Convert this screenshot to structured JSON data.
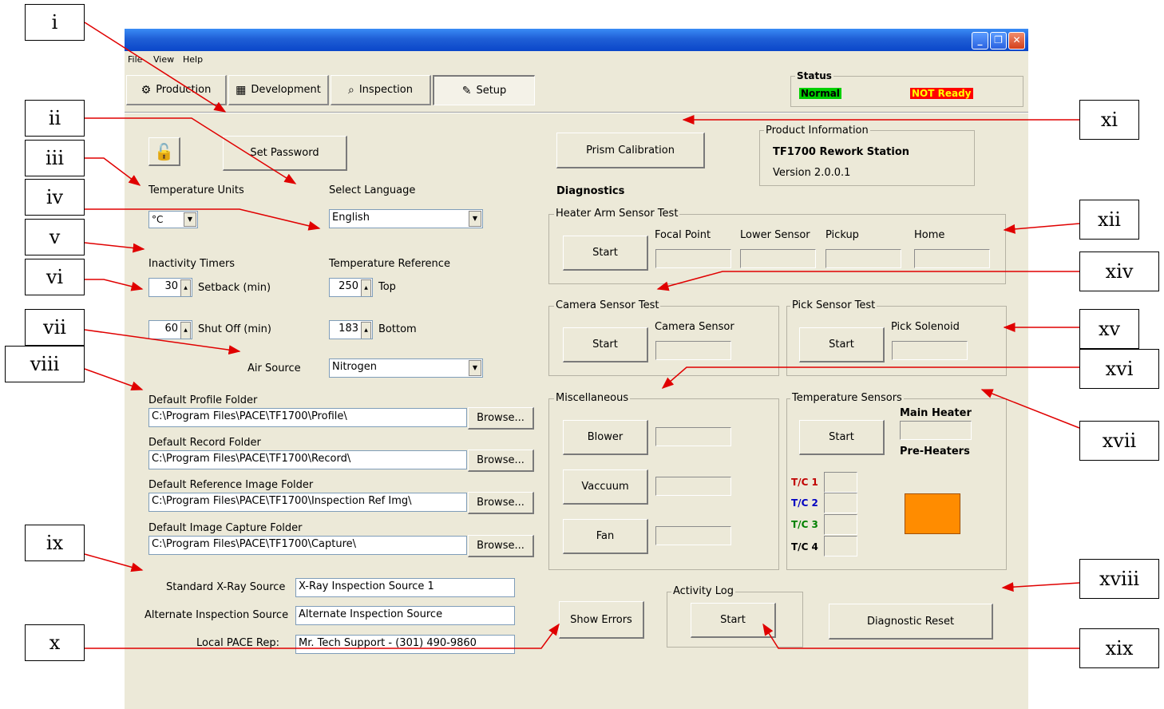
{
  "menu": {
    "file": "File",
    "view": "View",
    "help": "Help"
  },
  "tabs": [
    {
      "label": "Production",
      "icon": "production-icon"
    },
    {
      "label": "Development",
      "icon": "calculator-icon"
    },
    {
      "label": "Inspection",
      "icon": "magnifier-icon"
    },
    {
      "label": "Setup",
      "icon": "setup-icon"
    }
  ],
  "status": {
    "title": "Status",
    "normal": "Normal",
    "not_ready": "NOT Ready",
    "normal_color": "#00d000",
    "not_ready_color": "#ff0000"
  },
  "setup": {
    "set_password": "Set Password",
    "temperature_units_label": "Temperature Units",
    "temperature_units_value": "°C",
    "select_language_label": "Select Language",
    "language_value": "English",
    "inactivity_timers_label": "Inactivity Timers",
    "setback_value": "30",
    "setback_label": "Setback (min)",
    "shutoff_value": "60",
    "shutoff_label": "Shut Off (min)",
    "temp_reference_label": "Temperature Reference",
    "top_value": "250",
    "top_label": "Top",
    "bottom_value": "183",
    "bottom_label": "Bottom",
    "air_source_label": "Air Source",
    "air_source_value": "Nitrogen",
    "browse": "Browse...",
    "folders": [
      {
        "label": "Default Profile Folder",
        "value": "C:\\Program Files\\PACE\\TF1700\\Profile\\"
      },
      {
        "label": "Default Record Folder",
        "value": "C:\\Program Files\\PACE\\TF1700\\Record\\"
      },
      {
        "label": "Default Reference Image Folder",
        "value": "C:\\Program Files\\PACE\\TF1700\\Inspection Ref Img\\"
      },
      {
        "label": "Default Image Capture Folder",
        "value": "C:\\Program Files\\PACE\\TF1700\\Capture\\"
      }
    ],
    "standard_xray_label": "Standard X-Ray Source",
    "standard_xray_value": "X-Ray Inspection Source 1",
    "alternate_label": "Alternate Inspection Source",
    "alternate_value": "Alternate Inspection Source",
    "local_rep_label": "Local PACE Rep:",
    "local_rep_value": "Mr. Tech Support - (301) 490-9860"
  },
  "right": {
    "prism_calibration": "Prism Calibration",
    "product_info_title": "Product Information",
    "product_name": "TF1700 Rework Station",
    "version": "Version 2.0.0.1",
    "diagnostics": "Diagnostics",
    "heater_arm_title": "Heater Arm Sensor Test",
    "start": "Start",
    "focal_point": "Focal Point",
    "lower_sensor": "Lower Sensor",
    "pickup": "Pickup",
    "home": "Home",
    "camera_sensor_title": "Camera Sensor Test",
    "camera_sensor": "Camera Sensor",
    "pick_sensor_title": "Pick Sensor Test",
    "pick_solenoid": "Pick Solenoid",
    "misc_title": "Miscellaneous",
    "blower": "Blower",
    "vaccuum": "Vaccuum",
    "fan": "Fan",
    "temp_sensors_title": "Temperature Sensors",
    "main_heater": "Main Heater",
    "pre_heaters": "Pre-Heaters",
    "tc1": "T/C 1",
    "tc2": "T/C 2",
    "tc3": "T/C 3",
    "tc4": "T/C 4",
    "tc_colors": [
      "#c00000",
      "#0000c0",
      "#008000",
      "#000000"
    ],
    "heater_color": "#ff8c00",
    "show_errors": "Show Errors",
    "activity_log_title": "Activity Log",
    "diagnostic_reset": "Diagnostic Reset"
  },
  "callouts": [
    "i",
    "ii",
    "iii",
    "iv",
    "v",
    "vi",
    "vii",
    "viii",
    "ix",
    "x",
    "xi",
    "xii",
    "xiv",
    "xv",
    "xvi",
    "xvii",
    "xviii",
    "xix"
  ]
}
